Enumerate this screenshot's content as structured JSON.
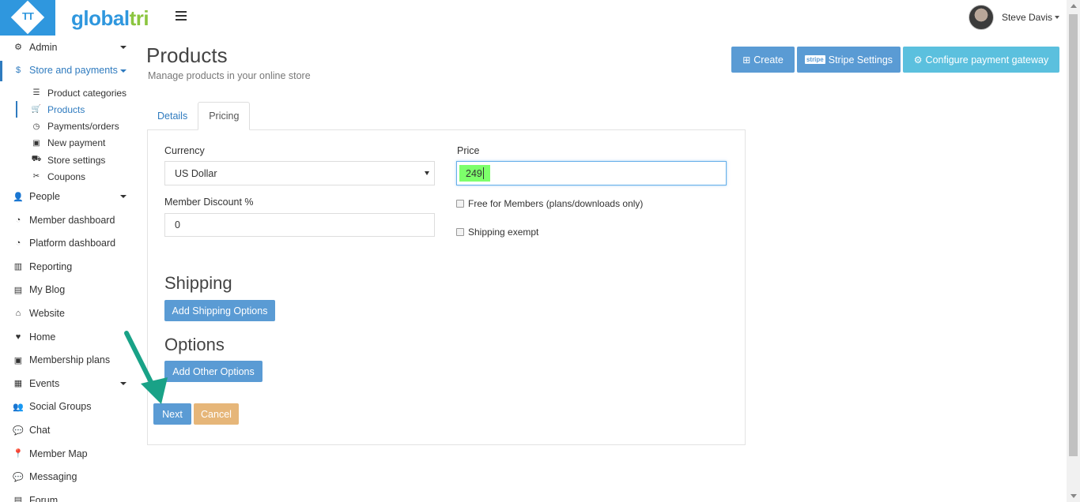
{
  "brand": {
    "logo_text": "TT",
    "name_part1": "global",
    "name_part2": "tri",
    "logo_color": "#2f97de",
    "accent_green": "#8bc53f"
  },
  "user": {
    "name": "Steve Davis"
  },
  "sidebar": {
    "items": [
      {
        "label": "Admin",
        "icon": "gears-icon",
        "glyph": "⚙",
        "has_caret": true
      },
      {
        "label": "Store and payments",
        "icon": "dollar-icon",
        "glyph": "$",
        "has_caret": true,
        "active": true
      },
      {
        "label": "People",
        "icon": "user-icon",
        "glyph": "👤",
        "has_caret": true
      },
      {
        "label": "Member dashboard",
        "icon": "dashboard-icon",
        "glyph": "◔"
      },
      {
        "label": "Platform dashboard",
        "icon": "dashboard-icon",
        "glyph": "◔"
      },
      {
        "label": "Reporting",
        "icon": "bar-chart-icon",
        "glyph": "▥"
      },
      {
        "label": "My Blog",
        "icon": "newspaper-icon",
        "glyph": "▤"
      },
      {
        "label": "Website",
        "icon": "home-icon",
        "glyph": "⌂"
      },
      {
        "label": "Home",
        "icon": "heartbeat-icon",
        "glyph": "♥"
      },
      {
        "label": "Membership plans",
        "icon": "money-icon",
        "glyph": "▣"
      },
      {
        "label": "Events",
        "icon": "calendar-icon",
        "glyph": "▦",
        "has_caret": true
      },
      {
        "label": "Social Groups",
        "icon": "users-icon",
        "glyph": "👥"
      },
      {
        "label": "Chat",
        "icon": "comments-icon",
        "glyph": "💬"
      },
      {
        "label": "Member Map",
        "icon": "map-marker-icon",
        "glyph": "📍"
      },
      {
        "label": "Messaging",
        "icon": "comment-icon",
        "glyph": "💬"
      },
      {
        "label": "Forum",
        "icon": "forum-icon",
        "glyph": "▤"
      }
    ],
    "sub_items": [
      {
        "label": "Product categories",
        "icon": "list-icon",
        "glyph": "☰"
      },
      {
        "label": "Products",
        "icon": "cart-icon",
        "glyph": "🛒",
        "active": true
      },
      {
        "label": "Payments/orders",
        "icon": "clock-icon",
        "glyph": "◷"
      },
      {
        "label": "New payment",
        "icon": "money-icon",
        "glyph": "▣"
      },
      {
        "label": "Store settings",
        "icon": "truck-icon",
        "glyph": "⛟"
      },
      {
        "label": "Coupons",
        "icon": "scissors-icon",
        "glyph": "✂"
      }
    ]
  },
  "page": {
    "title": "Products",
    "subtitle": "Manage products in your online store"
  },
  "header_buttons": {
    "create": "Create",
    "stripe_badge": "stripe",
    "stripe": "Stripe Settings",
    "gateway": "Configure payment gateway"
  },
  "tabs": [
    {
      "label": "Details"
    },
    {
      "label": "Pricing",
      "active": true
    }
  ],
  "form": {
    "currency_label": "Currency",
    "currency_value": "US Dollar",
    "price_label": "Price",
    "price_value": "249",
    "discount_label": "Member Discount %",
    "discount_value": "0",
    "free_members_label": "Free for Members (plans/downloads only)",
    "shipping_exempt_label": "Shipping exempt"
  },
  "shipping": {
    "title": "Shipping",
    "button": "Add Shipping Options"
  },
  "options": {
    "title": "Options",
    "button": "Add Other Options"
  },
  "actions": {
    "next": "Next",
    "cancel": "Cancel"
  },
  "colors": {
    "primary_button": "#5a9bd4",
    "info_button": "#5bc0de",
    "cancel_button": "#e6b679",
    "highlight": "#7dff6b",
    "annotation_arrow": "#19a287"
  }
}
